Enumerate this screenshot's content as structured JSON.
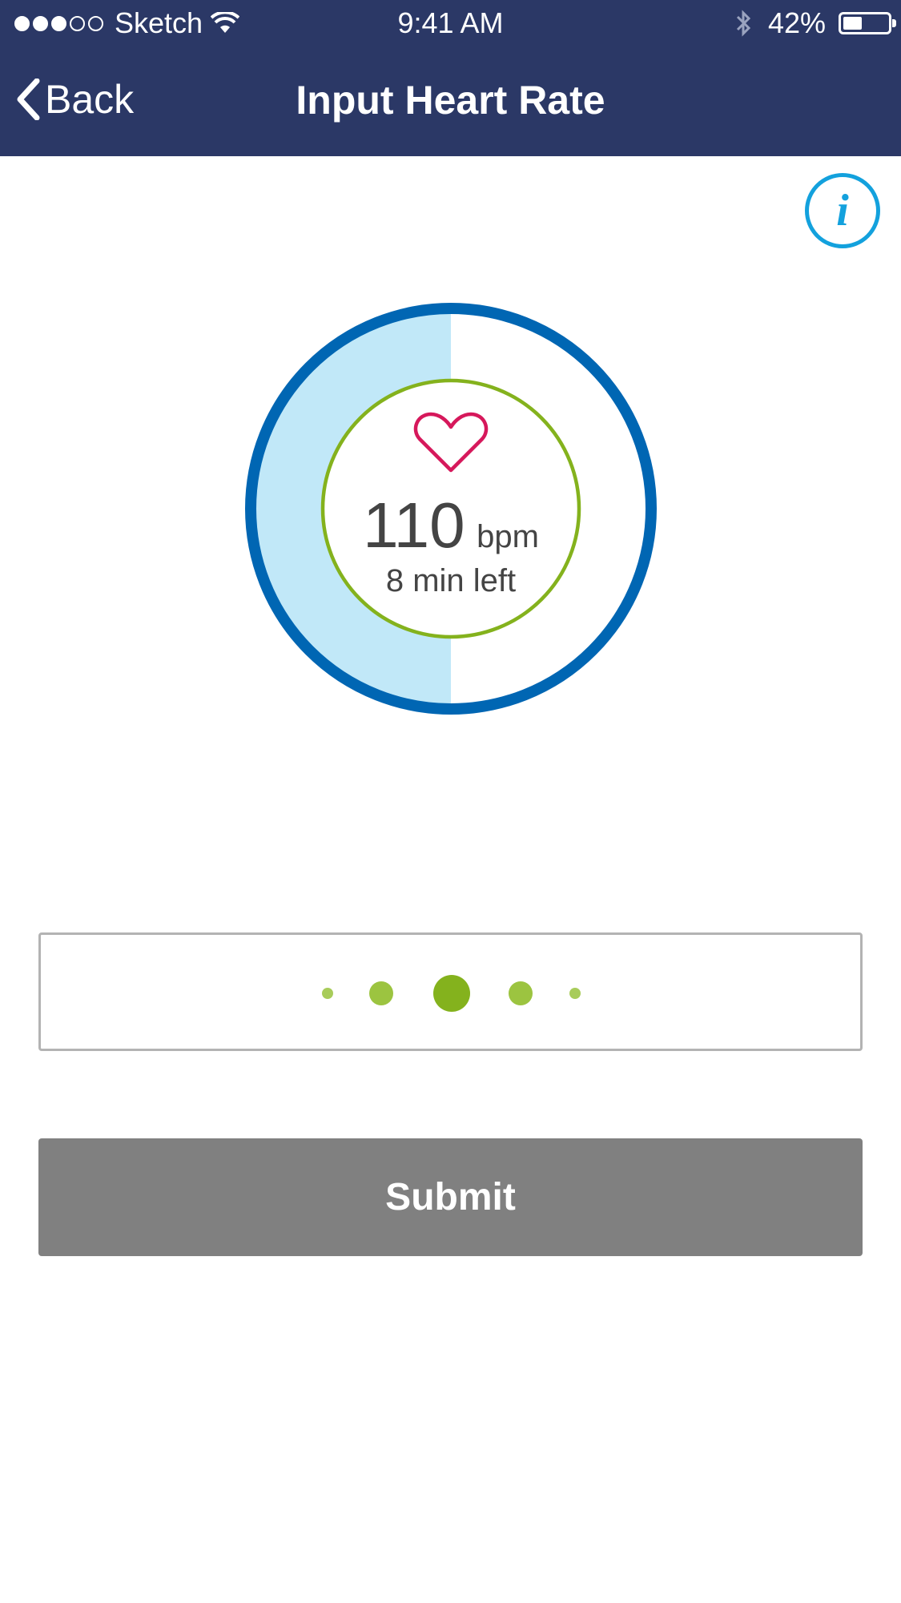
{
  "status_bar": {
    "carrier": "Sketch",
    "time": "9:41 AM",
    "battery": "42%",
    "battery_level": 0.42,
    "signal_bars_filled": 3,
    "signal_bars_total": 5
  },
  "nav": {
    "back_label": "Back",
    "title": "Input Heart Rate"
  },
  "info_button": {
    "label": "i"
  },
  "gauge": {
    "heart_rate": "110",
    "unit": "bpm",
    "time_left": "8 min left",
    "progress": 0.5
  },
  "picker": {
    "value_count": 5,
    "selected_index": 2
  },
  "submit": {
    "label": "Submit"
  },
  "colors": {
    "nav_background": "#2b3866",
    "gauge_ring": "#0066b3",
    "gauge_fill": "#c1e8f8",
    "inner_ring": "#84b21d",
    "heart": "#d6185b",
    "info": "#13a1dd",
    "submit_background": "#808080"
  }
}
